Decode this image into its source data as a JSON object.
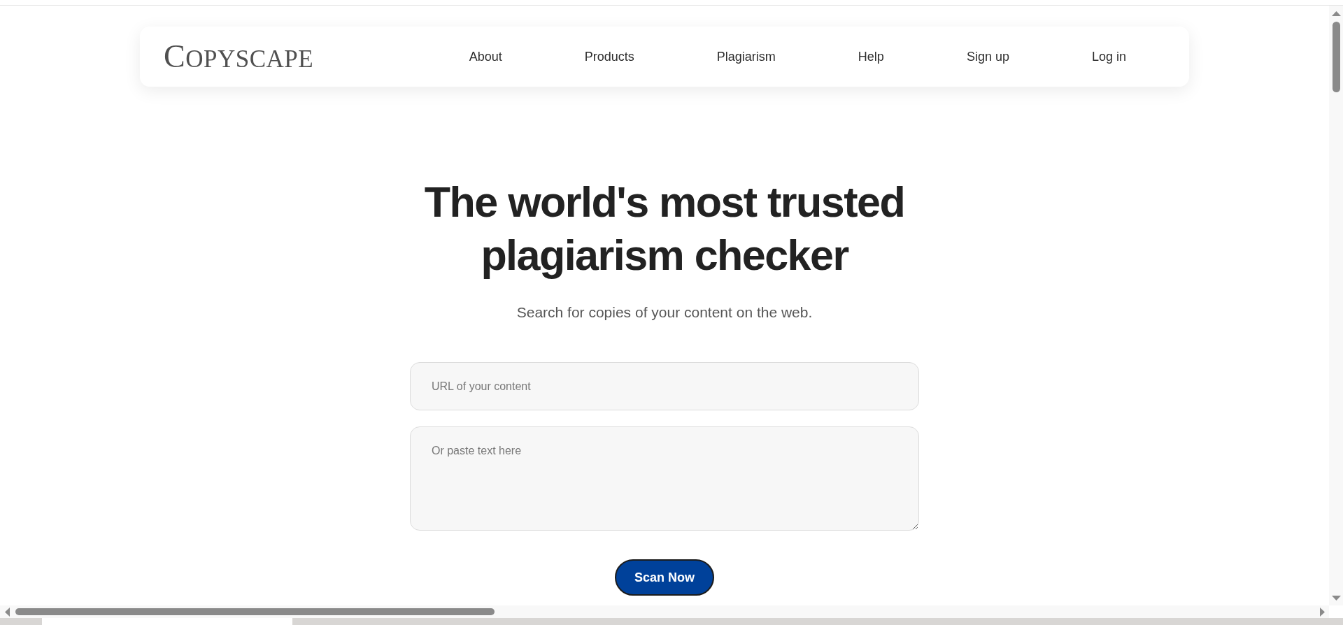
{
  "logo": {
    "text": "COPYSCAPE"
  },
  "nav": {
    "items": [
      {
        "label": "About"
      },
      {
        "label": "Products"
      },
      {
        "label": "Plagiarism"
      },
      {
        "label": "Help"
      },
      {
        "label": "Sign up"
      },
      {
        "label": "Log in"
      }
    ]
  },
  "hero": {
    "title": "The world's most trusted plagiarism checker",
    "subtitle": "Search for copies of your content on the web."
  },
  "form": {
    "url_field": {
      "placeholder": "URL of your content"
    },
    "text_field": {
      "placeholder": "Or paste text here"
    },
    "submit_button": "Scan Now"
  }
}
